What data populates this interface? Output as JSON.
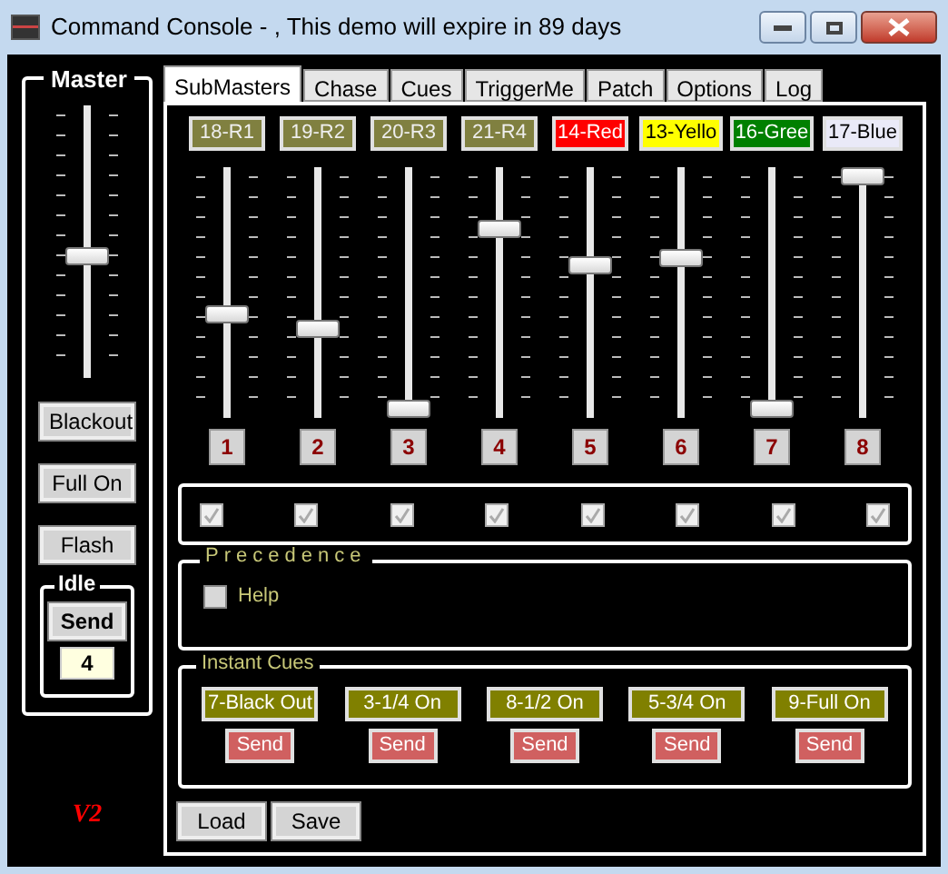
{
  "window": {
    "title": "Command Console - , This demo will expire in 89 days"
  },
  "master": {
    "title": "Master",
    "level": 0.44,
    "buttons": [
      "Blackout",
      "Full On",
      "Flash"
    ],
    "idle": {
      "title": "Idle",
      "button": "Send",
      "value": "4"
    },
    "version": "V2"
  },
  "tabs": [
    {
      "label": "SubMasters",
      "selected": true
    },
    {
      "label": "Chase",
      "selected": false
    },
    {
      "label": "Cues",
      "selected": false
    },
    {
      "label": "TriggerMe",
      "selected": false
    },
    {
      "label": "Patch",
      "selected": false
    },
    {
      "label": "Options",
      "selected": false
    },
    {
      "label": "Log",
      "selected": false
    }
  ],
  "channels": [
    {
      "name": "18-R1",
      "color": "#808040",
      "level": 0.41,
      "number": "1",
      "checked": true
    },
    {
      "name": "19-R2",
      "color": "#808040",
      "level": 0.34,
      "number": "2",
      "checked": true
    },
    {
      "name": "20-R3",
      "color": "#808040",
      "level": 0.0,
      "number": "3",
      "checked": true
    },
    {
      "name": "21-R4",
      "color": "#808040",
      "level": 0.77,
      "number": "4",
      "checked": true
    },
    {
      "name": "14-Red",
      "color": "#ff0000",
      "level": 0.62,
      "number": "5",
      "checked": true
    },
    {
      "name": "13-Yello",
      "color": "#ffff00",
      "level": 0.65,
      "number": "6",
      "checked": true
    },
    {
      "name": "16-Gree",
      "color": "#008000",
      "level": 0.0,
      "number": "7",
      "checked": true
    },
    {
      "name": "17-Blue",
      "color": "#eaeaf8",
      "level": 1.0,
      "number": "8",
      "checked": true
    }
  ],
  "checkboxes_disabled": true,
  "precedence": {
    "title": "Precedence",
    "option": {
      "label": "Help",
      "checked": false
    }
  },
  "instant_cues": {
    "title": "Instant Cues",
    "cues": [
      {
        "name": "7-Black Out",
        "button": "Send"
      },
      {
        "name": "3-1/4 On",
        "button": "Send"
      },
      {
        "name": "8-1/2 On",
        "button": "Send"
      },
      {
        "name": "5-3/4 On",
        "button": "Send"
      },
      {
        "name": "9-Full On",
        "button": "Send"
      }
    ]
  },
  "footer_buttons": [
    "Load",
    "Save"
  ]
}
